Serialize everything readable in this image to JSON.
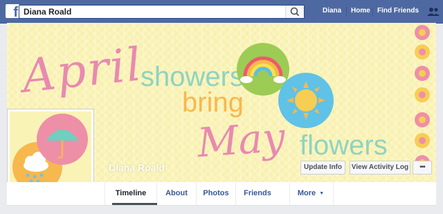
{
  "header": {
    "logo_glyph": "f",
    "search_value": "Diana Roald",
    "nav": [
      "Diana",
      "Home",
      "Find Friends"
    ]
  },
  "cover": {
    "word_april": "April",
    "word_showers": "showers",
    "word_bring": "bring",
    "word_may": "May",
    "word_flowers": "flowers",
    "colors": {
      "background": "#faf3b6",
      "pink_script": "#e88ab0",
      "teal_text": "#8ed3c1",
      "orange_text": "#f7b84d",
      "flower_pink": "#ee8fa8",
      "flower_yellow": "#f7cd54"
    }
  },
  "profile": {
    "name": "Diana Roald",
    "buttons": {
      "update_info": "Update Info",
      "activity_log": "View Activity Log",
      "more_dots": "•••"
    }
  },
  "tabs": [
    "Timeline",
    "About",
    "Photos",
    "Friends",
    "More"
  ],
  "tabs_more_arrow": "▼",
  "colors": {
    "topbar": "#4e69a2",
    "page_bg": "#e9ebee",
    "link": "#365899"
  }
}
